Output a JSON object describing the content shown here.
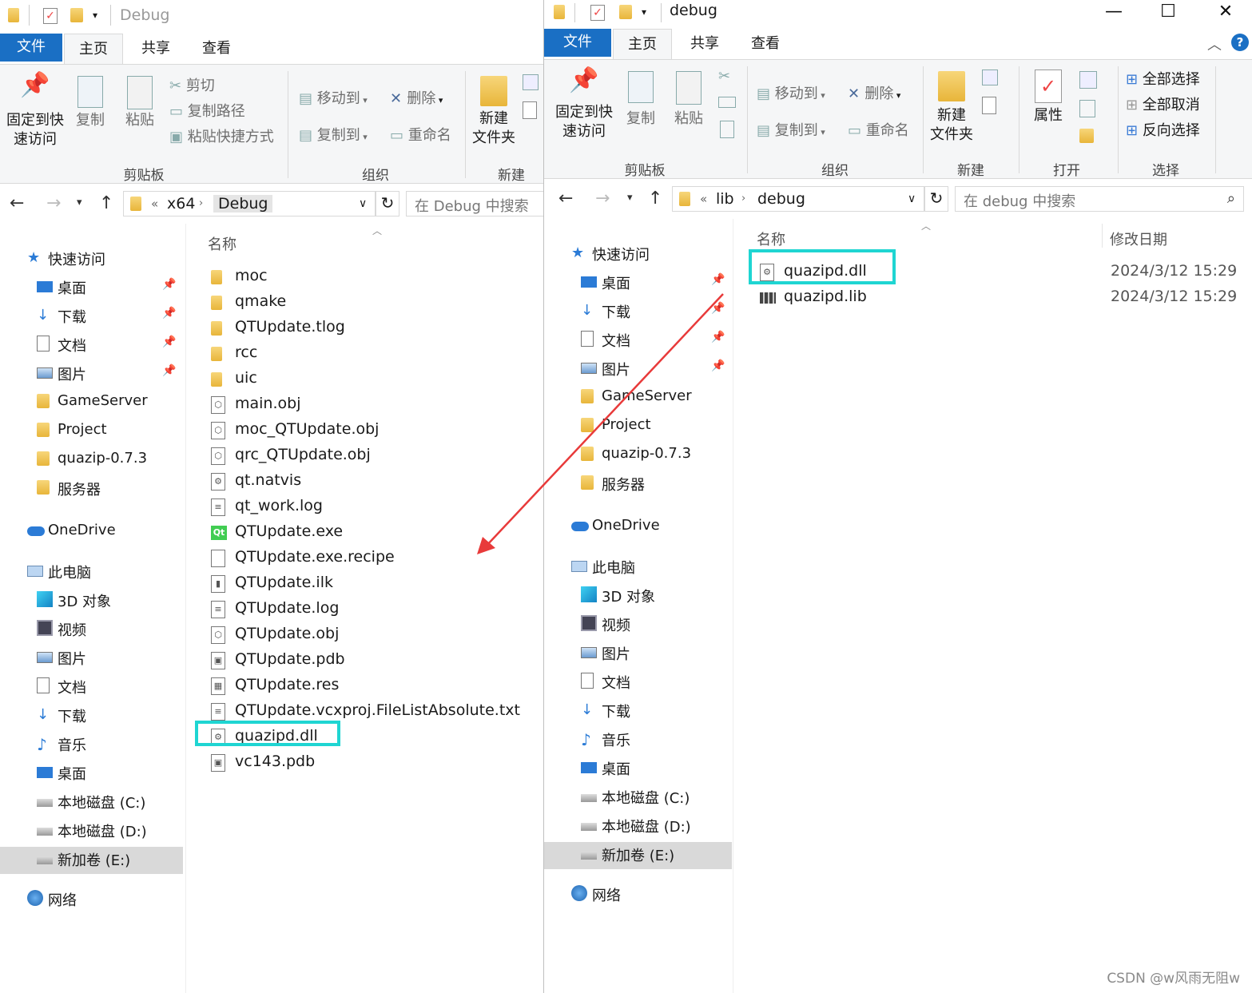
{
  "left": {
    "title": "Debug",
    "tabs": {
      "file": "文件",
      "home": "主页",
      "share": "共享",
      "view": "查看"
    },
    "ribbon": {
      "pin": "固定到快速访问",
      "pin_l1": "固定到快",
      "pin_l2": "速访问",
      "copy": "复制",
      "paste": "粘贴",
      "cut": "剪切",
      "copy_path": "复制路径",
      "paste_shortcut": "粘贴快捷方式",
      "move_to": "移动到",
      "copy_to": "复制到",
      "delete": "删除",
      "rename": "重命名",
      "new_folder_l1": "新建",
      "new_folder_l2": "文件夹",
      "group_clipboard": "剪贴板",
      "group_organize": "组织",
      "group_new": "新建"
    },
    "address": {
      "chevrons": "«",
      "crumbs": [
        "x64",
        "Debug"
      ],
      "search_placeholder": "在 Debug 中搜索"
    },
    "col_name": "名称",
    "nav": [
      {
        "label": "快速访问",
        "icon": "star-icon"
      },
      {
        "label": "桌面",
        "icon": "desktop-icon",
        "pinned": true
      },
      {
        "label": "下载",
        "icon": "download-icon",
        "pinned": true
      },
      {
        "label": "文档",
        "icon": "document-icon",
        "pinned": true
      },
      {
        "label": "图片",
        "icon": "pictures-icon",
        "pinned": true
      },
      {
        "label": "GameServer",
        "icon": "folder-icon"
      },
      {
        "label": "Project",
        "icon": "folder-icon"
      },
      {
        "label": "quazip-0.7.3",
        "icon": "folder-icon"
      },
      {
        "label": "服务器",
        "icon": "folder-icon"
      },
      {
        "label": "OneDrive",
        "icon": "cloud-icon"
      },
      {
        "label": "此电脑",
        "icon": "computer-icon"
      },
      {
        "label": "3D 对象",
        "icon": "cube-icon"
      },
      {
        "label": "视频",
        "icon": "video-icon"
      },
      {
        "label": "图片",
        "icon": "pictures-icon"
      },
      {
        "label": "文档",
        "icon": "document-icon"
      },
      {
        "label": "下载",
        "icon": "download-icon"
      },
      {
        "label": "音乐",
        "icon": "music-icon"
      },
      {
        "label": "桌面",
        "icon": "desktop-icon"
      },
      {
        "label": "本地磁盘 (C:)",
        "icon": "drive-c-icon"
      },
      {
        "label": "本地磁盘 (D:)",
        "icon": "drive-icon"
      },
      {
        "label": "新加卷 (E:)",
        "icon": "drive-icon",
        "selected": true
      },
      {
        "label": "网络",
        "icon": "network-icon"
      }
    ],
    "files": [
      {
        "name": "moc",
        "icon": "folder-icon"
      },
      {
        "name": "qmake",
        "icon": "folder-icon"
      },
      {
        "name": "QTUpdate.tlog",
        "icon": "folder-icon"
      },
      {
        "name": "rcc",
        "icon": "folder-icon"
      },
      {
        "name": "uic",
        "icon": "folder-icon"
      },
      {
        "name": "main.obj",
        "icon": "obj-file-icon"
      },
      {
        "name": "moc_QTUpdate.obj",
        "icon": "obj-file-icon"
      },
      {
        "name": "qrc_QTUpdate.obj",
        "icon": "obj-file-icon"
      },
      {
        "name": "qt.natvis",
        "icon": "natvis-file-icon"
      },
      {
        "name": "qt_work.log",
        "icon": "text-file-icon"
      },
      {
        "name": "QTUpdate.exe",
        "icon": "qt-exe-icon"
      },
      {
        "name": "QTUpdate.exe.recipe",
        "icon": "blank-file-icon"
      },
      {
        "name": "QTUpdate.ilk",
        "icon": "ilk-file-icon"
      },
      {
        "name": "QTUpdate.log",
        "icon": "text-file-icon"
      },
      {
        "name": "QTUpdate.obj",
        "icon": "obj-file-icon"
      },
      {
        "name": "QTUpdate.pdb",
        "icon": "pdb-file-icon"
      },
      {
        "name": "QTUpdate.res",
        "icon": "res-file-icon"
      },
      {
        "name": "QTUpdate.vcxproj.FileListAbsolute.txt",
        "icon": "text-file-icon"
      },
      {
        "name": "quazipd.dll",
        "icon": "dll-file-icon",
        "highlighted": true
      },
      {
        "name": "vc143.pdb",
        "icon": "pdb-file-icon"
      }
    ]
  },
  "right": {
    "title": "debug",
    "tabs": {
      "file": "文件",
      "home": "主页",
      "share": "共享",
      "view": "查看"
    },
    "window_controls": {
      "minimize": "—",
      "maximize": "☐",
      "close": "✕"
    },
    "ribbon": {
      "pin_l1": "固定到快",
      "pin_l2": "速访问",
      "copy": "复制",
      "paste": "粘贴",
      "move_to": "移动到",
      "copy_to": "复制到",
      "delete": "删除",
      "rename": "重命名",
      "new_folder_l1": "新建",
      "new_folder_l2": "文件夹",
      "properties": "属性",
      "select_all": "全部选择",
      "select_none": "全部取消",
      "invert_selection": "反向选择",
      "group_clipboard": "剪贴板",
      "group_organize": "组织",
      "group_new": "新建",
      "group_open": "打开",
      "group_select": "选择"
    },
    "address": {
      "chevrons": "«",
      "crumbs": [
        "lib",
        "debug"
      ],
      "search_placeholder": "在 debug 中搜索"
    },
    "col_name": "名称",
    "col_modified": "修改日期",
    "nav": [
      {
        "label": "快速访问",
        "icon": "star-icon"
      },
      {
        "label": "桌面",
        "icon": "desktop-icon",
        "pinned": true
      },
      {
        "label": "下载",
        "icon": "download-icon",
        "pinned": true
      },
      {
        "label": "文档",
        "icon": "document-icon",
        "pinned": true
      },
      {
        "label": "图片",
        "icon": "pictures-icon",
        "pinned": true
      },
      {
        "label": "GameServer",
        "icon": "folder-icon"
      },
      {
        "label": "Project",
        "icon": "folder-icon"
      },
      {
        "label": "quazip-0.7.3",
        "icon": "folder-icon"
      },
      {
        "label": "服务器",
        "icon": "folder-icon"
      },
      {
        "label": "OneDrive",
        "icon": "cloud-icon"
      },
      {
        "label": "此电脑",
        "icon": "computer-icon"
      },
      {
        "label": "3D 对象",
        "icon": "cube-icon"
      },
      {
        "label": "视频",
        "icon": "video-icon"
      },
      {
        "label": "图片",
        "icon": "pictures-icon"
      },
      {
        "label": "文档",
        "icon": "document-icon"
      },
      {
        "label": "下载",
        "icon": "download-icon"
      },
      {
        "label": "音乐",
        "icon": "music-icon"
      },
      {
        "label": "桌面",
        "icon": "desktop-icon"
      },
      {
        "label": "本地磁盘 (C:)",
        "icon": "drive-c-icon"
      },
      {
        "label": "本地磁盘 (D:)",
        "icon": "drive-icon"
      },
      {
        "label": "新加卷 (E:)",
        "icon": "drive-icon",
        "selected": true
      },
      {
        "label": "网络",
        "icon": "network-icon"
      }
    ],
    "files": [
      {
        "name": "quazipd.dll",
        "date": "2024/3/12 15:29",
        "icon": "dll-file-icon",
        "highlighted": true
      },
      {
        "name": "quazipd.lib",
        "date": "2024/3/12 15:29",
        "icon": "lib-file-icon"
      }
    ]
  },
  "colors": {
    "accent": "#1a6fc4",
    "highlight_box": "#1fd5d2",
    "arrow": "#e83a3a",
    "selected_nav": "#d9d9d9"
  },
  "watermark": "CSDN @w风雨无阻w"
}
